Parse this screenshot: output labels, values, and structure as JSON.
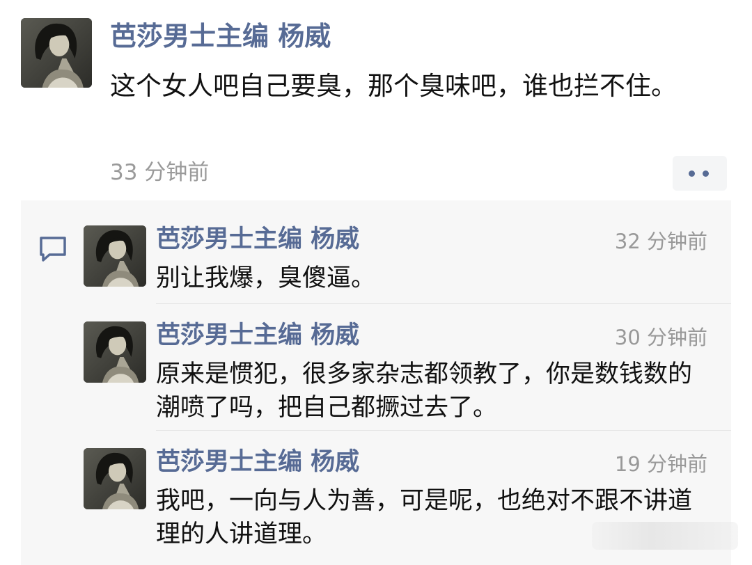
{
  "post": {
    "author": "芭莎男士主编 杨威",
    "text": "这个女人吧自己要臭，那个臭味吧，谁也拦不住。",
    "time": "33 分钟前",
    "more_icon": "two-dots-icon"
  },
  "comments": [
    {
      "author": "芭莎男士主编 杨威",
      "time": "32 分钟前",
      "text": "别让我爆，臭傻逼。"
    },
    {
      "author": "芭莎男士主编 杨威",
      "time": "30 分钟前",
      "text": "原来是惯犯，很多家杂志都领教了，你是数钱数的潮喷了吗，把自己都撅过去了。"
    },
    {
      "author": "芭莎男士主编 杨威",
      "time": "19 分钟前",
      "text": "我吧，一向与人为善，可是呢，也绝对不跟不讲道理的人讲道理。"
    }
  ],
  "colors": {
    "name": "#576b95",
    "text": "#111111",
    "time": "#9a9a9a",
    "comment_bg": "#f7f7f7"
  }
}
